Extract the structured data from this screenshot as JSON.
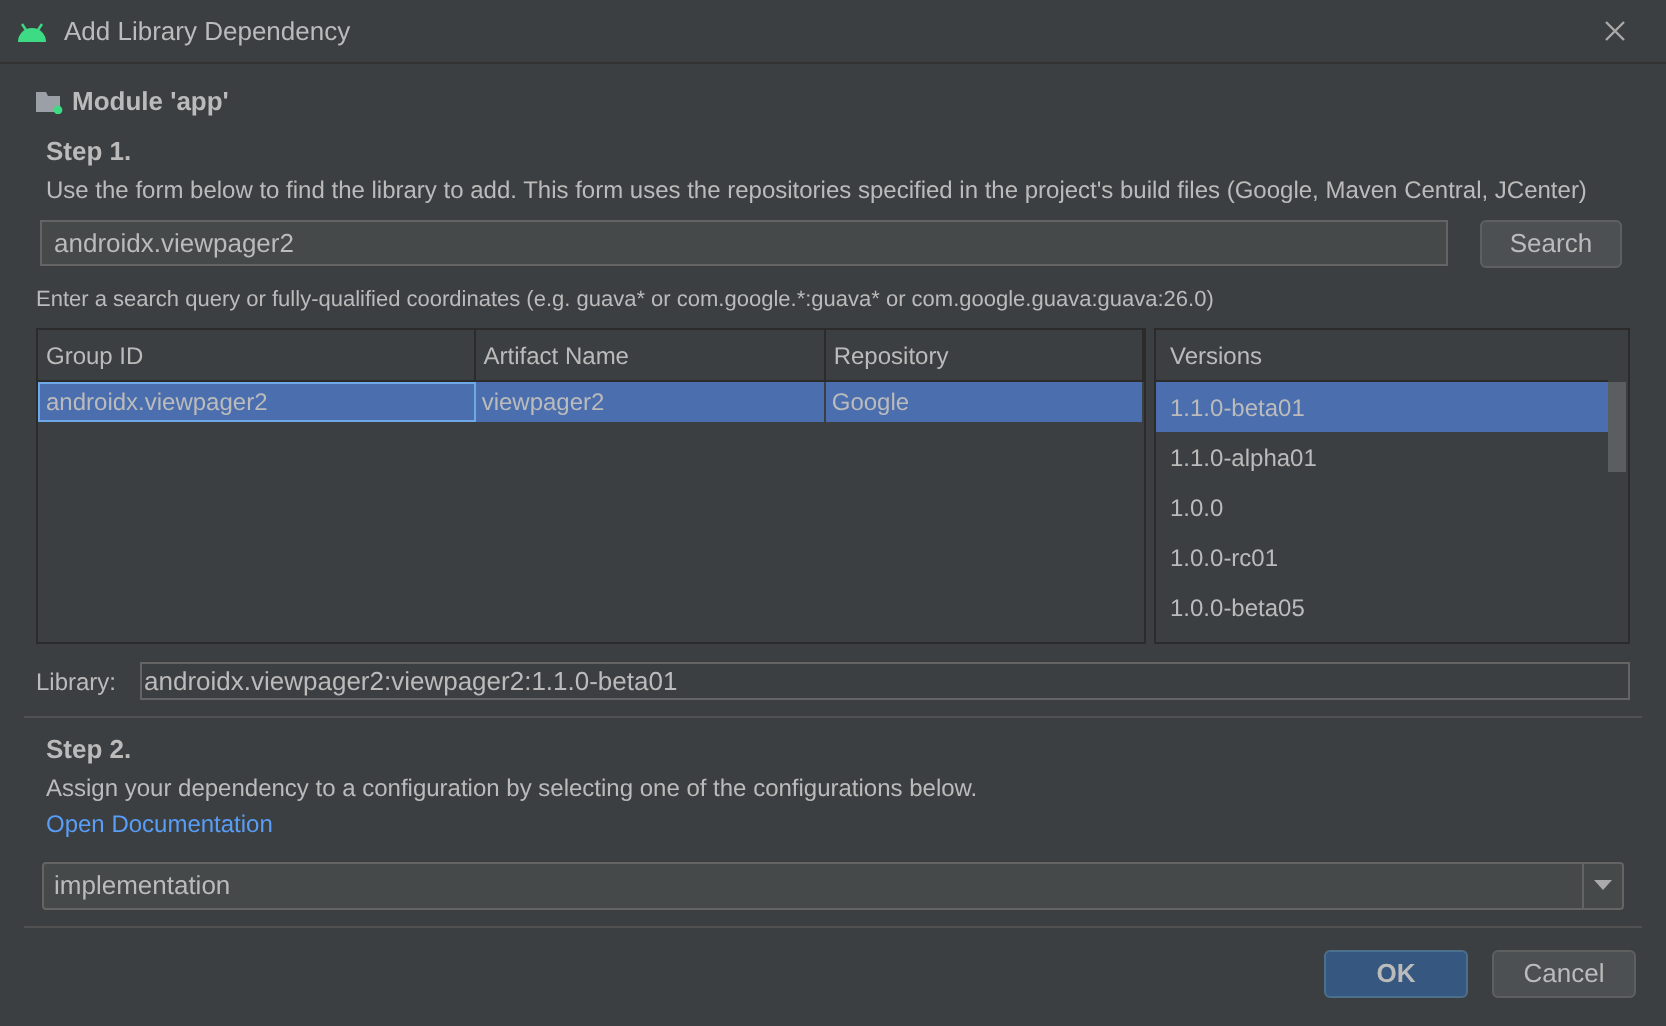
{
  "window": {
    "title": "Add Library Dependency"
  },
  "module": {
    "label": "Module 'app'"
  },
  "step1": {
    "heading": "Step 1.",
    "description": "Use the form below to find the library to add. This form uses the repositories specified in the project's build files (Google, Maven Central, JCenter)"
  },
  "search": {
    "value": "androidx.viewpager2",
    "button": "Search",
    "hint": "Enter a search query or fully-qualified coordinates (e.g. guava* or com.google.*:guava* or com.google.guava:guava:26.0)"
  },
  "table": {
    "columns": [
      "Group ID",
      "Artifact Name",
      "Repository"
    ],
    "rows": [
      {
        "cells": [
          "androidx.viewpager2",
          "viewpager2",
          "Google"
        ],
        "selected": true
      }
    ]
  },
  "versions": {
    "heading": "Versions",
    "items": [
      {
        "label": "1.1.0-beta01",
        "selected": true
      },
      {
        "label": "1.1.0-alpha01",
        "selected": false
      },
      {
        "label": "1.0.0",
        "selected": false
      },
      {
        "label": "1.0.0-rc01",
        "selected": false
      },
      {
        "label": "1.0.0-beta05",
        "selected": false
      }
    ]
  },
  "library": {
    "label": "Library:",
    "value": "androidx.viewpager2:viewpager2:1.1.0-beta01"
  },
  "step2": {
    "heading": "Step 2.",
    "description": "Assign your dependency to a configuration by selecting one of the configurations below.",
    "link": "Open Documentation"
  },
  "configuration": {
    "value": "implementation"
  },
  "buttons": [
    {
      "label": "OK",
      "kind": "primary"
    },
    {
      "label": "Cancel",
      "kind": "secondary"
    }
  ]
}
